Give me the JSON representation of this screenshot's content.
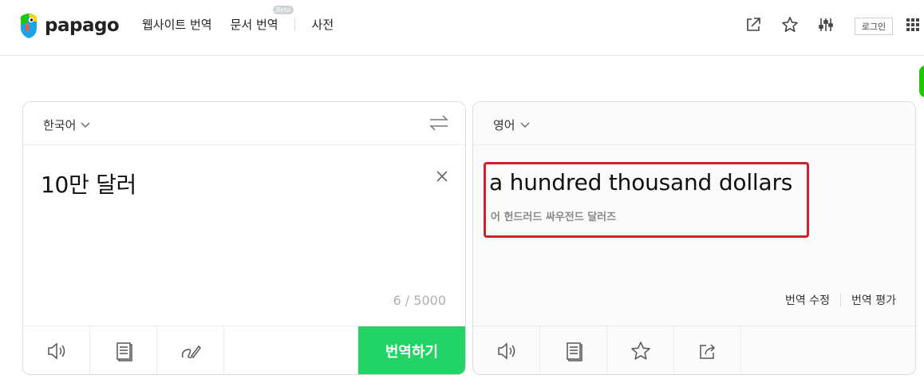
{
  "brand": {
    "name": "papago"
  },
  "nav": {
    "website_translate": "웹사이트 번역",
    "document_translate": "문서 번역",
    "beta_badge": "Beta",
    "dictionary": "사전"
  },
  "header": {
    "login_label": "로그인",
    "icons": [
      "share-window-icon",
      "star-icon",
      "settings-sliders-icon",
      "apps-grid-icon"
    ]
  },
  "source": {
    "language": "한국어",
    "text": "10만 달러",
    "char_count": "6 / 5000",
    "translate_button": "번역하기",
    "toolbar_icons": [
      "speaker-icon",
      "notebook-icon",
      "handwriting-icon"
    ]
  },
  "target": {
    "language": "영어",
    "text": "a hundred thousand dollars",
    "pronunciation": "어 헌드러드 싸우전드 달러즈",
    "edit_translation": "번역 수정",
    "rate_translation": "번역 평가",
    "toolbar_icons": [
      "speaker-icon",
      "notebook-icon",
      "star-icon",
      "share-icon"
    ]
  },
  "colors": {
    "accent_green": "#22d466",
    "highlight_red": "#d0202a"
  }
}
